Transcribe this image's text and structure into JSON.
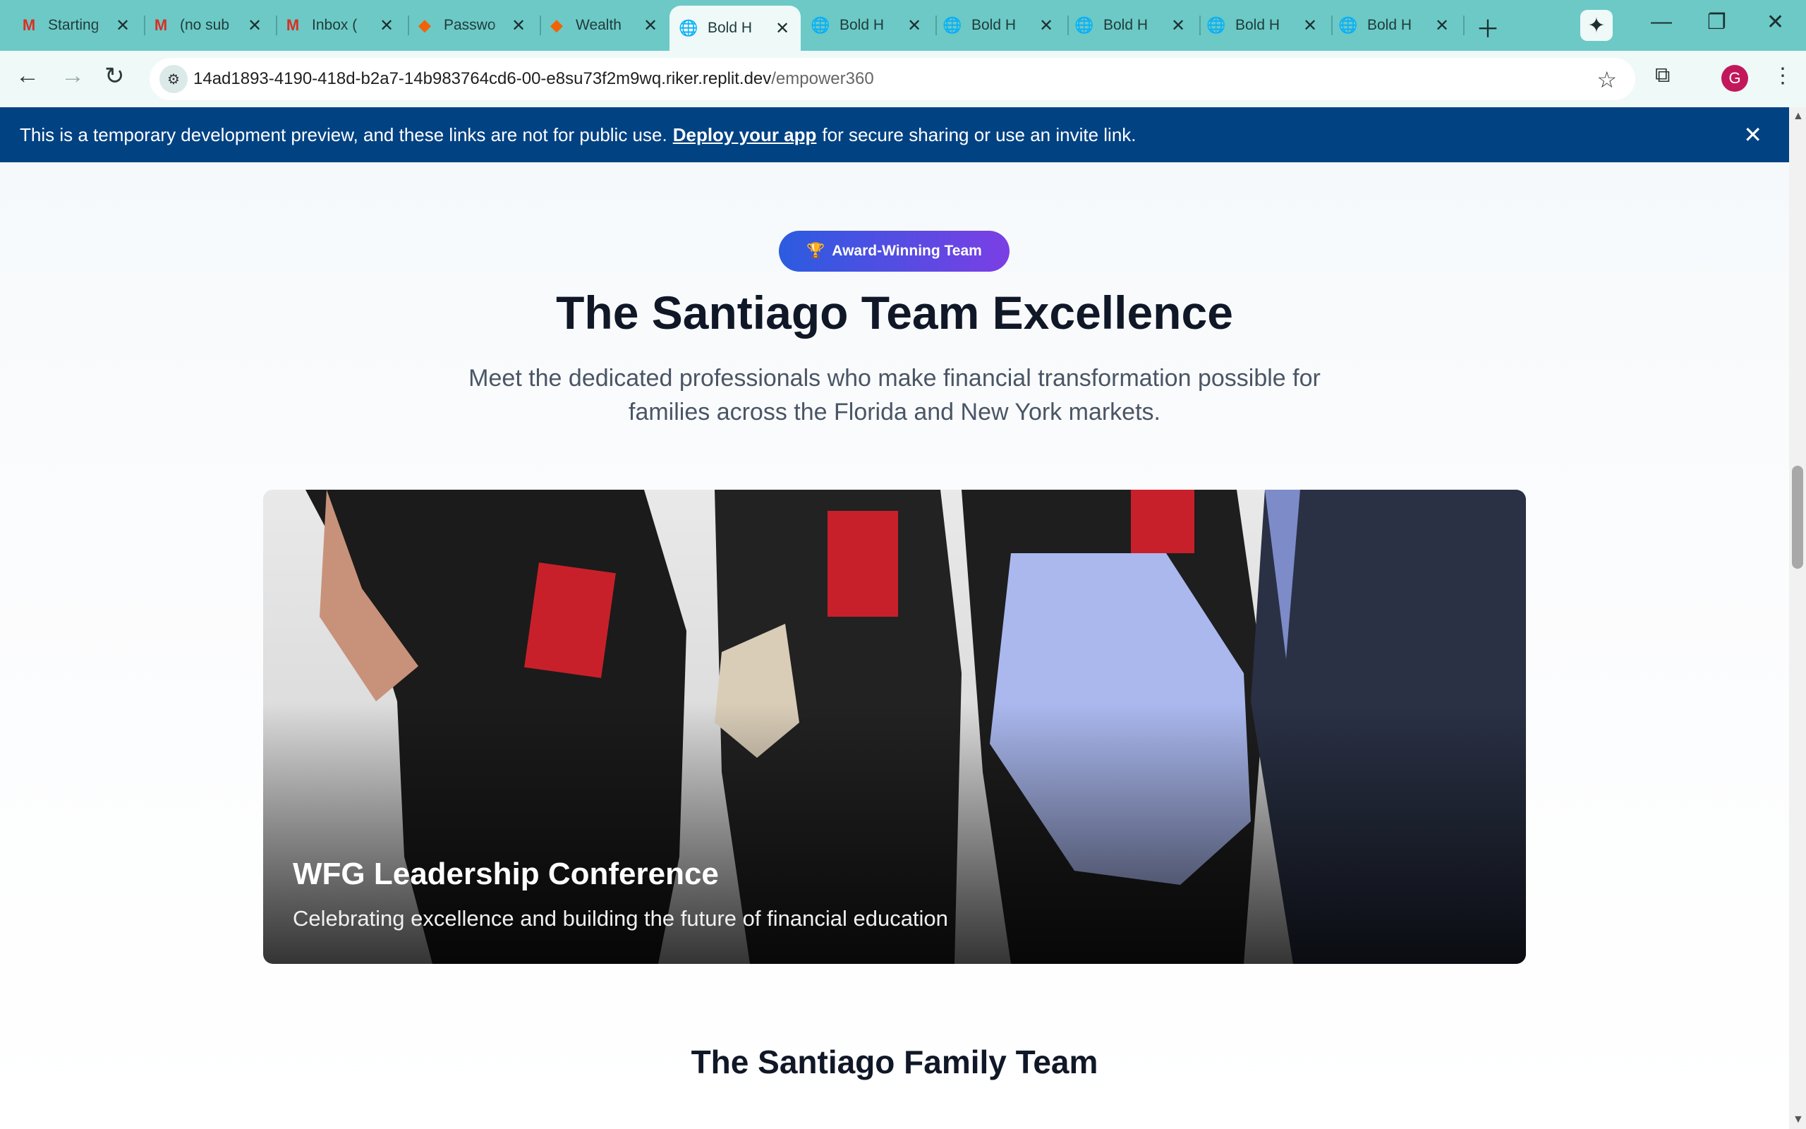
{
  "tabs": [
    {
      "label": "Starting",
      "icon": "gmail-icon"
    },
    {
      "label": "(no sub",
      "icon": "gmail-icon"
    },
    {
      "label": "Inbox (",
      "icon": "gmail-icon"
    },
    {
      "label": "Passwo",
      "icon": "replit-icon"
    },
    {
      "label": "Wealth",
      "icon": "replit-icon"
    },
    {
      "label": "Bold H",
      "icon": "globe-icon",
      "active": true
    },
    {
      "label": "Bold H",
      "icon": "globe-icon"
    },
    {
      "label": "Bold H",
      "icon": "globe-icon"
    },
    {
      "label": "Bold H",
      "icon": "globe-icon"
    },
    {
      "label": "Bold H",
      "icon": "globe-icon"
    },
    {
      "label": "Bold H",
      "icon": "globe-icon"
    }
  ],
  "address": {
    "host": "14ad1893-4190-418d-b2a7-14b983764cd6-00-e8su73f2m9wq.riker.replit.dev",
    "path": "/empower360"
  },
  "profile": {
    "initial": "G"
  },
  "banner": {
    "before": "This is a temporary development preview, and these links are not for public use.",
    "link": "Deploy your app",
    "after": "for secure sharing or use an invite link."
  },
  "section": {
    "badge_icon": "🏆",
    "badge": "Award-Winning Team",
    "title": "The Santiago Team Excellence",
    "subtitle": "Meet the dedicated professionals who make financial transformation possible for families across the Florida and New York markets.",
    "hero_title": "WFG Leadership Conference",
    "hero_subtitle": "Celebrating excellence and building the future of financial education",
    "family_title": "The Santiago Family Team"
  },
  "colors": {
    "tabbar": "#6cc9c6",
    "banner": "#014283",
    "badge_start": "#2b5ce0",
    "badge_end": "#7b3fe4"
  }
}
